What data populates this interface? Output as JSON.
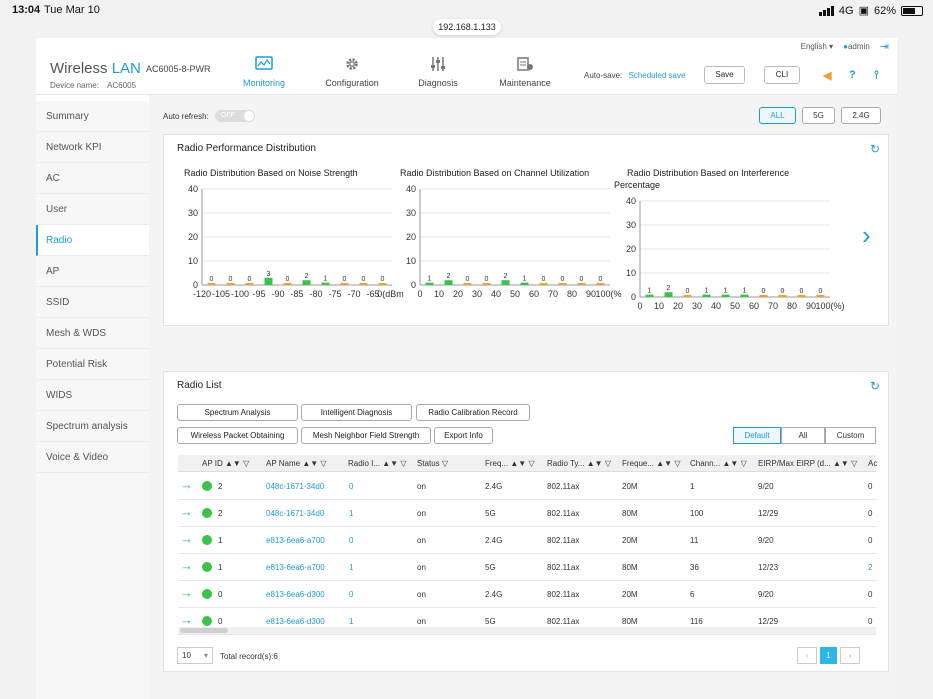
{
  "status_bar": {
    "time": "13:04",
    "date": "Tue Mar 10",
    "network": "4G",
    "battery": "62%"
  },
  "browser": {
    "url": "192.168.1.133"
  },
  "header": {
    "brand_wireless": "Wireless",
    "brand_lan": "LAN",
    "model": "AC6005-8-PWR",
    "device_name_label": "Device name:",
    "device_name": "AC6005",
    "language": "English",
    "user": "admin",
    "nav": [
      {
        "label": "Monitoring",
        "icon": "monitor-icon"
      },
      {
        "label": "Configuration",
        "icon": "gear-icon"
      },
      {
        "label": "Diagnosis",
        "icon": "sliders-icon"
      },
      {
        "label": "Maintenance",
        "icon": "maintenance-icon"
      }
    ],
    "autosave_label": "Auto-save:",
    "autosave_link": "Scheduled save",
    "save_label": "Save",
    "cli_label": "CLI"
  },
  "sidebar": {
    "items": [
      {
        "label": "Summary"
      },
      {
        "label": "Network KPI"
      },
      {
        "label": "AC"
      },
      {
        "label": "User"
      },
      {
        "label": "Radio"
      },
      {
        "label": "AP"
      },
      {
        "label": "SSID"
      },
      {
        "label": "Mesh & WDS"
      },
      {
        "label": "Potential Risk"
      },
      {
        "label": "WIDS"
      },
      {
        "label": "Spectrum analysis"
      },
      {
        "label": "Voice & Video"
      }
    ],
    "active": "Radio"
  },
  "filters": {
    "auto_refresh_label": "Auto refresh:",
    "auto_refresh_state": "OFF",
    "bands": [
      "ALL",
      "5G",
      "2.4G"
    ],
    "active_band": "ALL"
  },
  "perf_panel": {
    "title": "Radio Performance Distribution",
    "charts": {
      "noise": {
        "title": "Radio Distribution Based on Noise Strength"
      },
      "util": {
        "title": "Radio Distribution Based on Channel Utilization"
      },
      "interference": {
        "title": "Radio Distribution Based on Interference Percentage"
      }
    }
  },
  "chart_data": [
    {
      "type": "bar",
      "title": "Radio Distribution Based on Noise Strength",
      "categories": [
        "-120",
        "-105",
        "-100",
        "-95",
        "-90",
        "-85",
        "-80",
        "-75",
        "-70",
        "-65",
        "0(dBm)"
      ],
      "values": [
        0,
        0,
        0,
        3,
        0,
        2,
        1,
        0,
        0,
        0
      ],
      "ylim": [
        0,
        40
      ],
      "yticks": [
        "0",
        "10",
        "20",
        "30",
        "40"
      ],
      "grid": true
    },
    {
      "type": "bar",
      "title": "Radio Distribution Based on Channel Utilization",
      "categories": [
        "0",
        "10",
        "20",
        "30",
        "40",
        "50",
        "60",
        "70",
        "80",
        "90",
        "100(%)"
      ],
      "values": [
        1,
        2,
        0,
        0,
        2,
        1,
        0,
        0,
        0,
        0
      ],
      "ylim": [
        0,
        40
      ],
      "yticks": [
        "0",
        "10",
        "20",
        "30",
        "40"
      ],
      "grid": true
    },
    {
      "type": "bar",
      "title": "Radio Distribution Based on Interference Percentage",
      "categories": [
        "0",
        "10",
        "20",
        "30",
        "40",
        "50",
        "60",
        "70",
        "80",
        "90",
        "100(%)"
      ],
      "values": [
        1,
        2,
        0,
        1,
        1,
        1,
        0,
        0,
        0,
        0
      ],
      "ylim": [
        0,
        40
      ],
      "yticks": [
        "0",
        "10",
        "20",
        "30",
        "40"
      ],
      "grid": true
    }
  ],
  "radio_list": {
    "title": "Radio List",
    "buttons": [
      "Spectrum Analysis",
      "Intelligent Diagnosis",
      "Radio Calibration Record",
      "Wireless Packet Obtaining",
      "Mesh Neighbor Field Strength",
      "Export Info"
    ],
    "views": [
      "Default",
      "All",
      "Custom"
    ],
    "active_view": "Default",
    "columns": [
      "AP ID",
      "AP Name",
      "Radio I...",
      "Status",
      "Freq...",
      "Radio Ty...",
      "Freque...",
      "Chann...",
      "EIRP/Max EIRP (d...",
      "Ac"
    ],
    "rows": [
      {
        "ap_id": "2",
        "ap_name": "048c-1671-34d0",
        "radio_id": "0",
        "status": "on",
        "freq": "2.4G",
        "radio_type": "802.11ax",
        "bandwidth": "20M",
        "channel": "1",
        "eirp": "9/20",
        "ac": "0"
      },
      {
        "ap_id": "2",
        "ap_name": "048c-1671-34d0",
        "radio_id": "1",
        "status": "on",
        "freq": "5G",
        "radio_type": "802.11ax",
        "bandwidth": "80M",
        "channel": "100",
        "eirp": "12/29",
        "ac": "0"
      },
      {
        "ap_id": "1",
        "ap_name": "e813-6ea6-a700",
        "radio_id": "0",
        "status": "on",
        "freq": "2.4G",
        "radio_type": "802.11ax",
        "bandwidth": "20M",
        "channel": "11",
        "eirp": "9/20",
        "ac": "0"
      },
      {
        "ap_id": "1",
        "ap_name": "e813-6ea6-a700",
        "radio_id": "1",
        "status": "on",
        "freq": "5G",
        "radio_type": "802.11ax",
        "bandwidth": "80M",
        "channel": "36",
        "eirp": "12/23",
        "ac": "2"
      },
      {
        "ap_id": "0",
        "ap_name": "e813-6ea6-d300",
        "radio_id": "0",
        "status": "on",
        "freq": "2.4G",
        "radio_type": "802.11ax",
        "bandwidth": "20M",
        "channel": "6",
        "eirp": "9/20",
        "ac": "0"
      },
      {
        "ap_id": "0",
        "ap_name": "e813-6ea6-d300",
        "radio_id": "1",
        "status": "on",
        "freq": "5G",
        "radio_type": "802.11ax",
        "bandwidth": "80M",
        "channel": "116",
        "eirp": "12/29",
        "ac": "0"
      }
    ],
    "page_size": "10",
    "total_records": "Total record(s):6",
    "current_page": "1"
  },
  "colors": {
    "accent": "#1f9bd6",
    "bar": "#3bc24a",
    "bar_low": "#f0a030"
  }
}
